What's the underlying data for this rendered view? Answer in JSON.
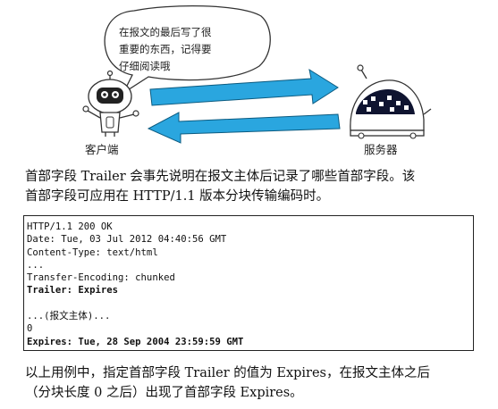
{
  "illustration": {
    "bubble_lines": [
      "在报文的最后写了很",
      "重要的东西，记得要",
      "仔细阅读哦"
    ],
    "client_label": "客户端",
    "server_label": "服务器",
    "arrow_color": "#2aa6df"
  },
  "intro_lines": [
    "首部字段 Trailer 会事先说明在报文主体后记录了哪些首部字段。该",
    "首部字段可应用在 HTTP/1.1 版本分块传输编码时。"
  ],
  "code_lines": [
    {
      "text": "HTTP/1.1 200 OK",
      "bold": false
    },
    {
      "text": "Date: Tue, 03 Jul 2012 04:40:56 GMT",
      "bold": false
    },
    {
      "text": "Content-Type: text/html",
      "bold": false
    },
    {
      "text": "...",
      "bold": false
    },
    {
      "text": "Transfer-Encoding: chunked",
      "bold": false
    },
    {
      "text": "Trailer: Expires",
      "bold": true
    },
    {
      "text": "",
      "bold": false
    },
    {
      "text": "...(报文主体)...",
      "bold": false
    },
    {
      "text": "0",
      "bold": false
    },
    {
      "text": "Expires: Tue, 28 Sep 2004 23:59:59 GMT",
      "bold": true
    }
  ],
  "outro_lines": [
    "以上用例中，指定首部字段 Trailer 的值为 Expires，在报文主体之后",
    "（分块长度 0 之后）出现了首部字段 Expires。"
  ]
}
